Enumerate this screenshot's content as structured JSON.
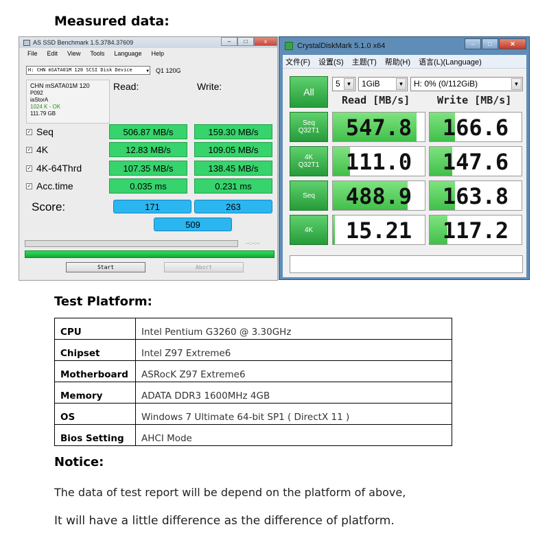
{
  "headings": {
    "measured": "Measured data:",
    "platform": "Test Platform:",
    "notice": "Notice:"
  },
  "asssd": {
    "title": "AS SSD Benchmark 1.5.3784.37609",
    "menu": [
      "File",
      "Edit",
      "View",
      "Tools",
      "Language",
      "Help"
    ],
    "device_select": "H: CHN mSATA01M 120 SCSI Disk Device",
    "device_model": "Q1 120G",
    "info": [
      "CHN mSATA01M 120",
      "P092",
      "iaStorA",
      "1024 K - OK",
      "111.79 GB"
    ],
    "col_read": "Read:",
    "col_write": "Write:",
    "rows": [
      {
        "label": "Seq",
        "read": "506.87 MB/s",
        "write": "159.30 MB/s"
      },
      {
        "label": "4K",
        "read": "12.83 MB/s",
        "write": "109.05 MB/s"
      },
      {
        "label": "4K-64Thrd",
        "read": "107.35 MB/s",
        "write": "138.45 MB/s"
      },
      {
        "label": "Acc.time",
        "read": "0.035 ms",
        "write": "0.231 ms"
      }
    ],
    "score_label": "Score:",
    "score_read": "171",
    "score_write": "263",
    "score_total": "509",
    "time_text": "--:--:--",
    "progress": 1.0,
    "start_button": "Start",
    "abort_button": "Abort"
  },
  "cdm": {
    "title": "CrystalDiskMark 5.1.0 x64",
    "menu": [
      "文件(F)",
      "设置(S)",
      "主题(T)",
      "帮助(H)",
      "语言(L)(Language)"
    ],
    "all_button": "All",
    "count_select": "5",
    "size_select": "1GiB",
    "drive_select": "H: 0% (0/112GiB)",
    "col_read": "Read [MB/s]",
    "col_write": "Write [MB/s]",
    "scale_max": 600,
    "rows": [
      {
        "label1": "Seq",
        "label2": "Q32T1",
        "read": "547.8",
        "write": "166.6"
      },
      {
        "label1": "4K",
        "label2": "Q32T1",
        "read": "111.0",
        "write": "147.6"
      },
      {
        "label1": "Seq",
        "label2": "",
        "read": "488.9",
        "write": "163.8"
      },
      {
        "label1": "4K",
        "label2": "",
        "read": "15.21",
        "write": "117.2"
      }
    ]
  },
  "platform": [
    {
      "key": "CPU",
      "value": "Intel Pentium G3260 @ 3.30GHz"
    },
    {
      "key": "Chipset",
      "value": "Intel Z97 Extreme6"
    },
    {
      "key": "Motherboard",
      "value": "ASRocK Z97 Extreme6"
    },
    {
      "key": "Memory",
      "value": "ADATA DDR3 1600MHz 4GB"
    },
    {
      "key": "OS",
      "value": "Windows 7 Ultimate 64-bit SP1 ( DirectX 11 )"
    },
    {
      "key": "Bios Setting",
      "value": "AHCI Mode"
    }
  ],
  "notice": {
    "line1": "The data of test report will be depend on the platform of above,",
    "line2": "It will have a little difference as the difference of platform."
  }
}
